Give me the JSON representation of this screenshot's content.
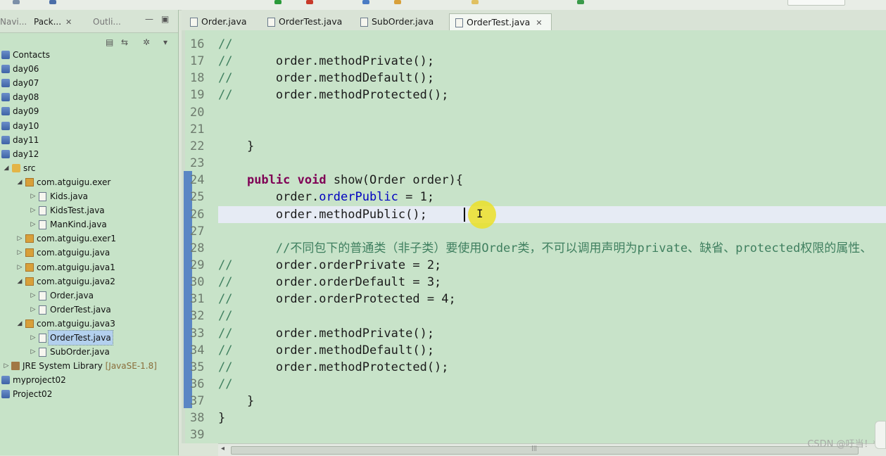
{
  "left_tabs": [
    {
      "label": "Navi...",
      "active": false
    },
    {
      "label": "Pack...",
      "active": true
    },
    {
      "label": "Outli...",
      "active": false
    }
  ],
  "tree": [
    {
      "label": "Contacts",
      "icon": "project-icon",
      "twisty": ""
    },
    {
      "label": "day06",
      "icon": "project-icon",
      "twisty": ""
    },
    {
      "label": "day07",
      "icon": "project-icon",
      "twisty": ""
    },
    {
      "label": "day08",
      "icon": "project-icon",
      "twisty": ""
    },
    {
      "label": "day09",
      "icon": "project-icon",
      "twisty": ""
    },
    {
      "label": "day10",
      "icon": "project-icon",
      "twisty": ""
    },
    {
      "label": "day11",
      "icon": "project-icon",
      "twisty": ""
    },
    {
      "label": "day12",
      "icon": "project-icon",
      "twisty": ""
    },
    {
      "label": "src",
      "icon": "source-folder-icon",
      "twisty": "◢"
    },
    {
      "label": "com.atguigu.exer",
      "icon": "package-icon",
      "twisty": "◢"
    },
    {
      "label": "Kids.java",
      "icon": "java-file-icon",
      "twisty": "▷"
    },
    {
      "label": "KidsTest.java",
      "icon": "java-file-icon",
      "twisty": "▷"
    },
    {
      "label": "ManKind.java",
      "icon": "java-file-icon",
      "twisty": "▷"
    },
    {
      "label": "com.atguigu.exer1",
      "icon": "package-icon",
      "twisty": "▷"
    },
    {
      "label": "com.atguigu.java",
      "icon": "package-icon",
      "twisty": "▷"
    },
    {
      "label": "com.atguigu.java1",
      "icon": "package-icon",
      "twisty": "▷"
    },
    {
      "label": "com.atguigu.java2",
      "icon": "package-icon",
      "twisty": "◢"
    },
    {
      "label": "Order.java",
      "icon": "java-file-icon",
      "twisty": "▷"
    },
    {
      "label": "OrderTest.java",
      "icon": "java-file-icon",
      "twisty": "▷"
    },
    {
      "label": "com.atguigu.java3",
      "icon": "package-icon",
      "twisty": "◢"
    },
    {
      "label": "OrderTest.java",
      "icon": "java-file-icon",
      "twisty": "▷",
      "selected": true
    },
    {
      "label": "SubOrder.java",
      "icon": "java-file-icon",
      "twisty": "▷"
    },
    {
      "label": "JRE System Library",
      "suffix": "[JavaSE-1.8]",
      "icon": "library-icon",
      "twisty": "▷"
    },
    {
      "label": "myproject02",
      "icon": "project-icon",
      "twisty": ""
    },
    {
      "label": "Project02",
      "icon": "project-icon",
      "twisty": ""
    }
  ],
  "editor_tabs": [
    {
      "label": "Order.java",
      "active": false
    },
    {
      "label": "OrderTest.java",
      "active": false
    },
    {
      "label": "SubOrder.java",
      "active": false
    },
    {
      "label": "OrderTest.java",
      "active": true,
      "close": "✕"
    }
  ],
  "code_lines": [
    {
      "n": "16",
      "segs": [
        {
          "t": "//",
          "c": "cm"
        }
      ]
    },
    {
      "n": "17",
      "segs": [
        {
          "t": "//      order.methodPrivate();",
          "c": "cm-code"
        }
      ]
    },
    {
      "n": "18",
      "segs": [
        {
          "t": "//      order.methodDefault();",
          "c": "cm-code"
        }
      ]
    },
    {
      "n": "19",
      "segs": [
        {
          "t": "//      order.methodProtected();",
          "c": "cm-code"
        }
      ]
    },
    {
      "n": "20",
      "segs": []
    },
    {
      "n": "21",
      "segs": []
    },
    {
      "n": "22",
      "segs": [
        {
          "t": "    }",
          "c": ""
        }
      ]
    },
    {
      "n": "23",
      "segs": []
    },
    {
      "n": "24",
      "segs": [
        {
          "t": "    ",
          "c": ""
        },
        {
          "t": "public",
          "c": "kw"
        },
        {
          "t": " ",
          "c": ""
        },
        {
          "t": "void",
          "c": "kw"
        },
        {
          "t": " show(Order order){",
          "c": ""
        }
      ]
    },
    {
      "n": "25",
      "segs": [
        {
          "t": "        order.",
          "c": ""
        },
        {
          "t": "orderPublic",
          "c": "fld"
        },
        {
          "t": " = 1;",
          "c": ""
        }
      ]
    },
    {
      "n": "26",
      "segs": [
        {
          "t": "        order.methodPublic();",
          "c": ""
        }
      ],
      "current": true
    },
    {
      "n": "27",
      "segs": []
    },
    {
      "n": "28",
      "segs": [
        {
          "t": "        //不同包下的普通类（非子类）要使用Order类，不可以调用声明为private、缺省、protected权限的属性、",
          "c": "cm"
        }
      ]
    },
    {
      "n": "29",
      "segs": [
        {
          "t": "//      order.orderPrivate = 2;",
          "c": "cm-code"
        }
      ]
    },
    {
      "n": "30",
      "segs": [
        {
          "t": "//      order.orderDefault = 3;",
          "c": "cm-code"
        }
      ]
    },
    {
      "n": "31",
      "segs": [
        {
          "t": "//      order.orderProtected = 4;",
          "c": "cm-code"
        }
      ]
    },
    {
      "n": "32",
      "segs": [
        {
          "t": "//",
          "c": "cm"
        }
      ]
    },
    {
      "n": "33",
      "segs": [
        {
          "t": "//      order.methodPrivate();",
          "c": "cm-code"
        }
      ]
    },
    {
      "n": "34",
      "segs": [
        {
          "t": "//      order.methodDefault();",
          "c": "cm-code"
        }
      ]
    },
    {
      "n": "35",
      "segs": [
        {
          "t": "//      order.methodProtected();",
          "c": "cm-code"
        }
      ]
    },
    {
      "n": "36",
      "segs": [
        {
          "t": "//",
          "c": "cm"
        }
      ]
    },
    {
      "n": "37",
      "segs": [
        {
          "t": "    }",
          "c": ""
        }
      ]
    },
    {
      "n": "38",
      "segs": [
        {
          "t": "}",
          "c": ""
        }
      ]
    },
    {
      "n": "39",
      "segs": []
    }
  ],
  "watermark": "CSDN @吁当！*",
  "colors": {
    "editor_bg": "#c8e3c9",
    "keyword": "#7f0055",
    "comment": "#3f7f5f",
    "field": "#0000c0",
    "highlight": "#ebe128"
  }
}
